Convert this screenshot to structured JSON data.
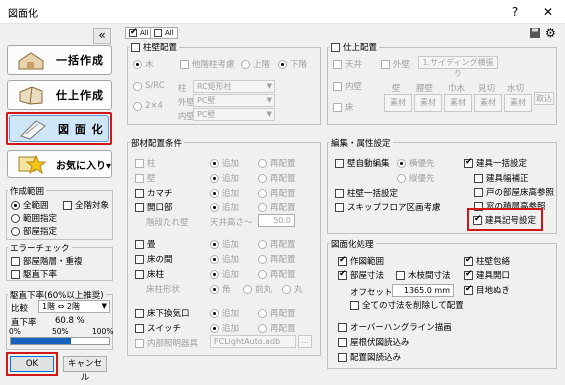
{
  "window": {
    "title": "図面化",
    "help": "?",
    "close": "✕"
  },
  "left": {
    "collapse": "«",
    "buttons": [
      {
        "label": "一括作成"
      },
      {
        "label": "仕上作成"
      },
      {
        "label": "図 面 化"
      },
      {
        "label": "お気に入り▾"
      }
    ],
    "range_group": {
      "title": "作成範囲",
      "all": "全範囲",
      "all_target": "全階対象",
      "range": "範囲指定",
      "part": "部屋指定"
    },
    "error_group": {
      "title": "エラーチェック",
      "stair": "部屋階層・重複",
      "ceiling": "駆直下率"
    },
    "ratio_group": {
      "title": "駆直下率(60%以上推奨)",
      "compare": "比較",
      "floors": "1階 ⇔ 2階",
      "ratio_label": "直下率",
      "ratio_value": "60.8 %",
      "ratio": 0.608,
      "p0": "0%",
      "p50": "50%",
      "p100": "100%"
    },
    "ok": "OK",
    "cancel": "キャンセル"
  },
  "top": {
    "all": "All",
    "all2": "All"
  },
  "pillar": {
    "title": "柱壁配置",
    "wood": "木",
    "other_pillar": "他階柱考慮",
    "up": "上階",
    "down": "下階",
    "src": "S/RC",
    "x24": "2×4",
    "pillar_label": "柱",
    "pillar_value": "RC矩形柱",
    "outer_label": "外壁",
    "outer_value": "PC壁",
    "inner_label": "内壁",
    "inner_value": "PC壁"
  },
  "finish": {
    "title": "仕上配置",
    "outer": "外壁",
    "outer_btn": "1.サイディング横張り",
    "ceiling": "天井",
    "inner": "内壁",
    "floor": "床",
    "heads": [
      "壁",
      "腰壁",
      "巾木",
      "見切",
      "水切"
    ],
    "material": "素材",
    "apply": "取込"
  },
  "members": {
    "title": "部材配置条件",
    "add": "追加",
    "re": "再配置",
    "rows": [
      {
        "label": "柱"
      },
      {
        "label": "壁"
      },
      {
        "label": "カマチ"
      },
      {
        "label": "開口部"
      }
    ],
    "wall_height": "階段たれ壁",
    "ceil_height": "天井高さ～",
    "height_value": "50.0",
    "rows2": [
      {
        "label": "畳"
      },
      {
        "label": "床の間"
      },
      {
        "label": "床柱"
      }
    ],
    "floor_shape": "床柱形状",
    "shape_a": "角",
    "shape_b": "前丸",
    "shape_c": "丸",
    "rows3": [
      {
        "label": "床下換気口"
      },
      {
        "label": "スイッチ"
      }
    ],
    "light": "内部照明器具",
    "light_value": "FCLightAuto.adb"
  },
  "edit": {
    "title": "編集・属性設定",
    "wall_auto": "壁自動編集",
    "priority_h": "横優先",
    "priority_v": "縦優先",
    "door_all": "建具一括設定",
    "door_width": "建具幅補正",
    "room_height": "戸の部屋床高参照",
    "pillar_all": "柱壁一括設定",
    "window_height": "窓の積層高参照",
    "skip": "スキップフロア区画考慮",
    "door_num": "建具記号設定"
  },
  "drawing": {
    "title": "図面化処理",
    "make": "作図範囲",
    "pillar_wrap": "柱壁包絡",
    "room_dim": "部屋寸法",
    "wood_dim": "木枝間寸法",
    "door_open": "建具開口",
    "offset": "オフセット",
    "offset_value": "1365.0 mm",
    "eye": "目地ぬき",
    "all_dim": "全ての寸法を削除して配置",
    "overhang": "オーバーハングライン描画",
    "roof": "屋根伏図読込み",
    "layout": "配置図読込み"
  },
  "colors": {
    "accent": "#d01818",
    "blue_bar": "#1565c0"
  }
}
